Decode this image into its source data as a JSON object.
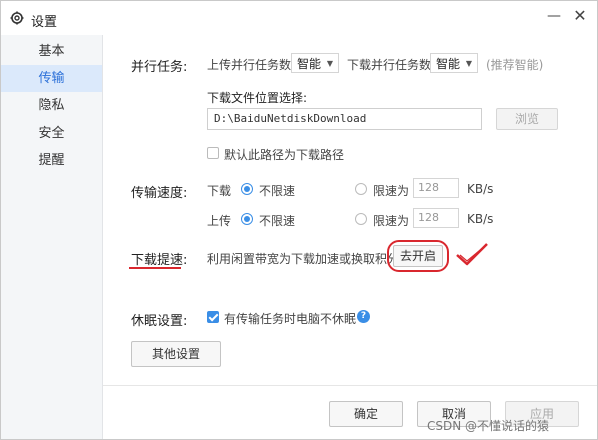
{
  "window": {
    "title": "设置",
    "minimize": "—",
    "close": "✕"
  },
  "sidebar": {
    "items": [
      {
        "label": "基本",
        "active": false
      },
      {
        "label": "传输",
        "active": true
      },
      {
        "label": "隐私",
        "active": false
      },
      {
        "label": "安全",
        "active": false
      },
      {
        "label": "提醒",
        "active": false
      }
    ]
  },
  "parallel": {
    "label": "并行任务:",
    "upload_label": "上传并行任务数",
    "upload_value": "智能",
    "download_label": "下载并行任务数",
    "download_value": "智能",
    "hint": "(推荐智能)"
  },
  "download_path": {
    "label": "下载文件位置选择:",
    "value": "D:\\BaiduNetdiskDownload",
    "browse": "浏览",
    "default_checkbox_label": "默认此路径为下载路径",
    "default_checked": false
  },
  "speed": {
    "label": "传输速度:",
    "download": {
      "label": "下载",
      "unlimited": "不限速",
      "limit": "限速为",
      "value": "128",
      "unit": "KB/s",
      "selected": "unlimited"
    },
    "upload": {
      "label": "上传",
      "unlimited": "不限速",
      "limit": "限速为",
      "value": "128",
      "unit": "KB/s",
      "selected": "unlimited"
    }
  },
  "accelerate": {
    "label": "下载提速:",
    "description": "利用闲置带宽为下载加速或换取积分",
    "button": "去开启"
  },
  "sleep": {
    "label": "休眠设置:",
    "checkbox_label": "有传输任务时电脑不休眠",
    "checked": true,
    "help": "?"
  },
  "other_settings": "其他设置",
  "footer": {
    "ok": "确定",
    "cancel": "取消",
    "apply": "应用"
  },
  "watermark": "CSDN @不懂说话的猿",
  "colors": {
    "accent": "#3a8ee6",
    "annotation": "#d9272e",
    "active_bg": "#dbe9fb"
  }
}
